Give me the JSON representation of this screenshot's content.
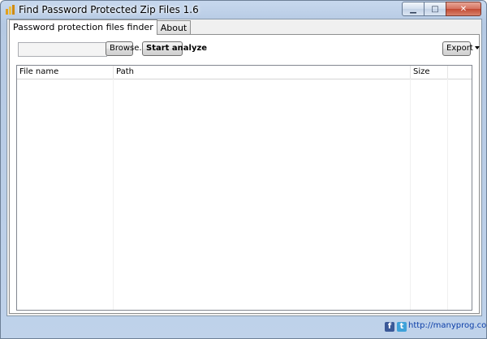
{
  "window": {
    "title": "Find Password Protected Zip Files 1.6"
  },
  "caption_buttons": {
    "minimize": "▁",
    "maximize": "□",
    "close": "✕"
  },
  "tabs": [
    {
      "label": "Password protection files finder",
      "active": true
    },
    {
      "label": "About",
      "active": false
    }
  ],
  "toolbar": {
    "path_value": "",
    "browse_label": "Browse...",
    "start_label": "Start analyze",
    "export_label": "Export"
  },
  "table": {
    "columns": [
      "File name",
      "Path",
      "Size",
      ""
    ],
    "rows": []
  },
  "footer": {
    "facebook_icon": "f",
    "twitter_icon": "t",
    "link_text": "http://manyprog.com"
  },
  "colors": {
    "window_frame": "#bfd2ea",
    "close_button": "#c24a33",
    "link": "#0b3ea8"
  }
}
